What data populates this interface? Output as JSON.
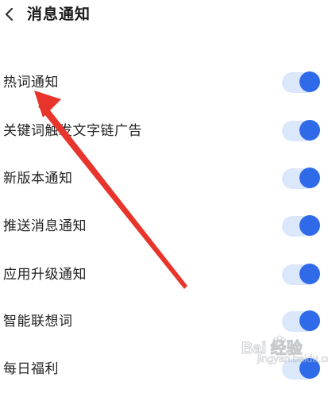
{
  "header": {
    "title": "消息通知",
    "back_icon": "chevron-left-icon"
  },
  "settings": [
    {
      "label": "热词通知",
      "enabled": true
    },
    {
      "label": "关键词触发文字链广告",
      "enabled": true
    },
    {
      "label": "新版本通知",
      "enabled": true
    },
    {
      "label": "推送消息通知",
      "enabled": true
    },
    {
      "label": "应用升级通知",
      "enabled": true
    },
    {
      "label": "智能联想词",
      "enabled": true
    },
    {
      "label": "每日福利",
      "enabled": true
    }
  ],
  "colors": {
    "toggle_on_knob": "#2f6ae8",
    "toggle_on_track": "#dbe7fb",
    "annotation_arrow": "#e8352b"
  },
  "annotation": {
    "type": "red-arrow",
    "points_to": "热词通知"
  },
  "watermark": {
    "text": "Bai  经验",
    "sub": "jingyan.baidu.com"
  }
}
